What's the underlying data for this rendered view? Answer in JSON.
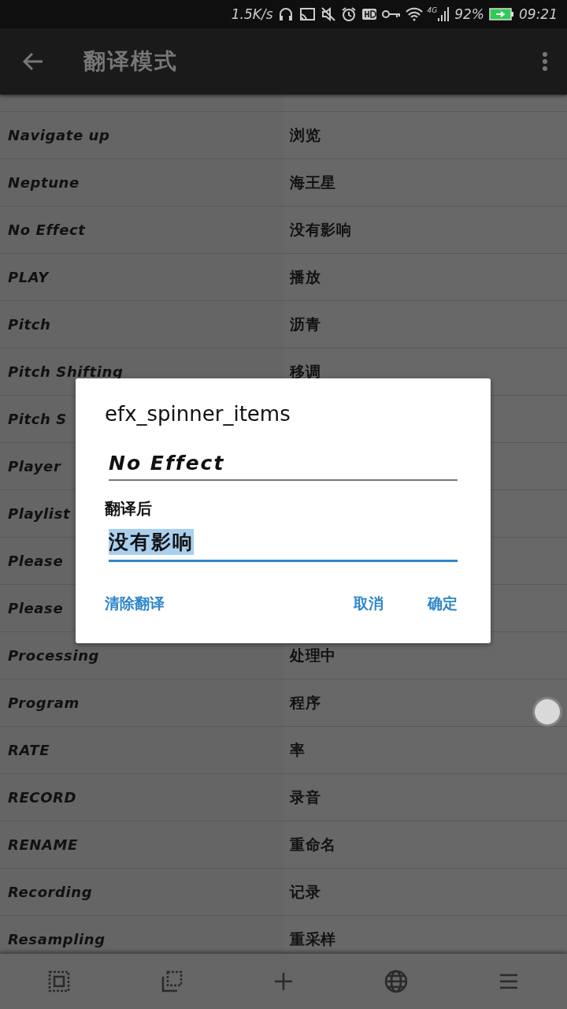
{
  "status_bar": {
    "speed": "1.5K/s",
    "network": "4G",
    "battery": "92%",
    "time": "09:21"
  },
  "toolbar": {
    "title": "翻译模式"
  },
  "rows": [
    {
      "source": "Navigate up",
      "translation": "浏览"
    },
    {
      "source": "Neptune",
      "translation": "海王星"
    },
    {
      "source": "No Effect",
      "translation": "没有影响"
    },
    {
      "source": "PLAY",
      "translation": "播放"
    },
    {
      "source": "Pitch",
      "translation": "沥青"
    },
    {
      "source": "Pitch Shifting",
      "translation": "移调"
    },
    {
      "source": "Pitch S"
    },
    {
      "source": "Player"
    },
    {
      "source": "Playlist"
    },
    {
      "source": "Please"
    },
    {
      "source": "Please"
    },
    {
      "source": "Processing",
      "translation": "处理中"
    },
    {
      "source": "Program",
      "translation": "程序"
    },
    {
      "source": "RATE",
      "translation": "率"
    },
    {
      "source": "RECORD",
      "translation": "录音"
    },
    {
      "source": "RENAME",
      "translation": "重命名"
    },
    {
      "source": "Recording",
      "translation": "记录"
    },
    {
      "source": "Resampling",
      "translation": "重采样"
    }
  ],
  "dialog": {
    "title": "efx_spinner_items",
    "source_field": {
      "value": "No Effect"
    },
    "label": "翻译后",
    "translation_field": {
      "value": "没有影响",
      "selected": true,
      "focused": true
    },
    "buttons": [
      {
        "label": "清除翻译"
      },
      {
        "label": "取消"
      },
      {
        "label": "确定"
      }
    ]
  }
}
